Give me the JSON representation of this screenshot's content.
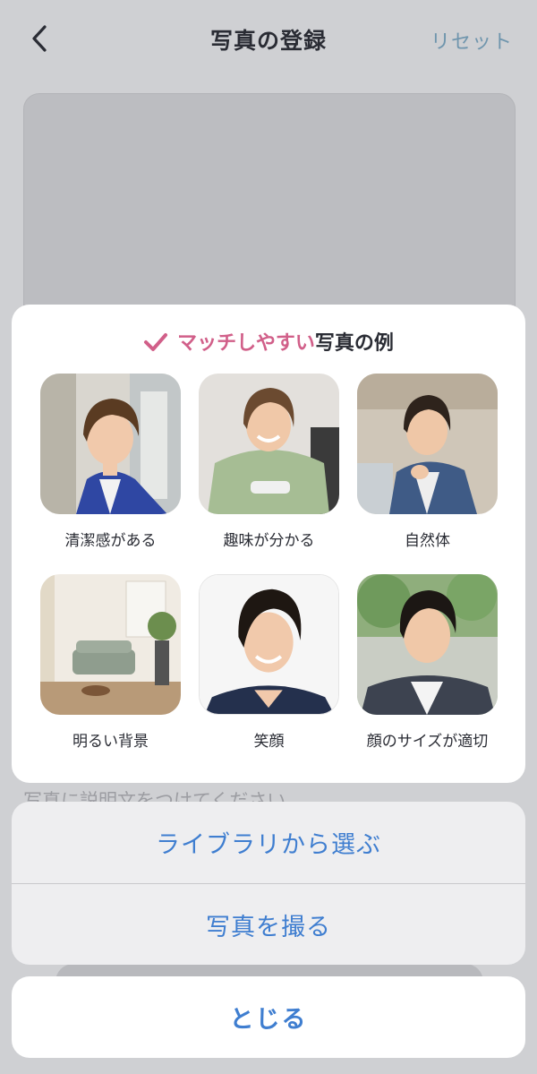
{
  "nav": {
    "title": "写真の登録",
    "reset_label": "リセット",
    "back_icon": "chevron-left-icon"
  },
  "form": {
    "description_placeholder": "写真に説明文をつけてください"
  },
  "examples_card": {
    "title_highlight": "マッチしやすい",
    "title_rest": "写真の例",
    "check_icon": "check-icon",
    "highlight_color": "#d15f89",
    "items": [
      {
        "label": "清潔感がある"
      },
      {
        "label": "趣味が分かる"
      },
      {
        "label": "自然体"
      },
      {
        "label": "明るい背景"
      },
      {
        "label": "笑顔"
      },
      {
        "label": "顔のサイズが適切"
      }
    ]
  },
  "action_sheet": {
    "library_label": "ライブラリから選ぶ",
    "camera_label": "写真を撮る",
    "close_label": "とじる",
    "accent_color": "#3f7ed0"
  }
}
